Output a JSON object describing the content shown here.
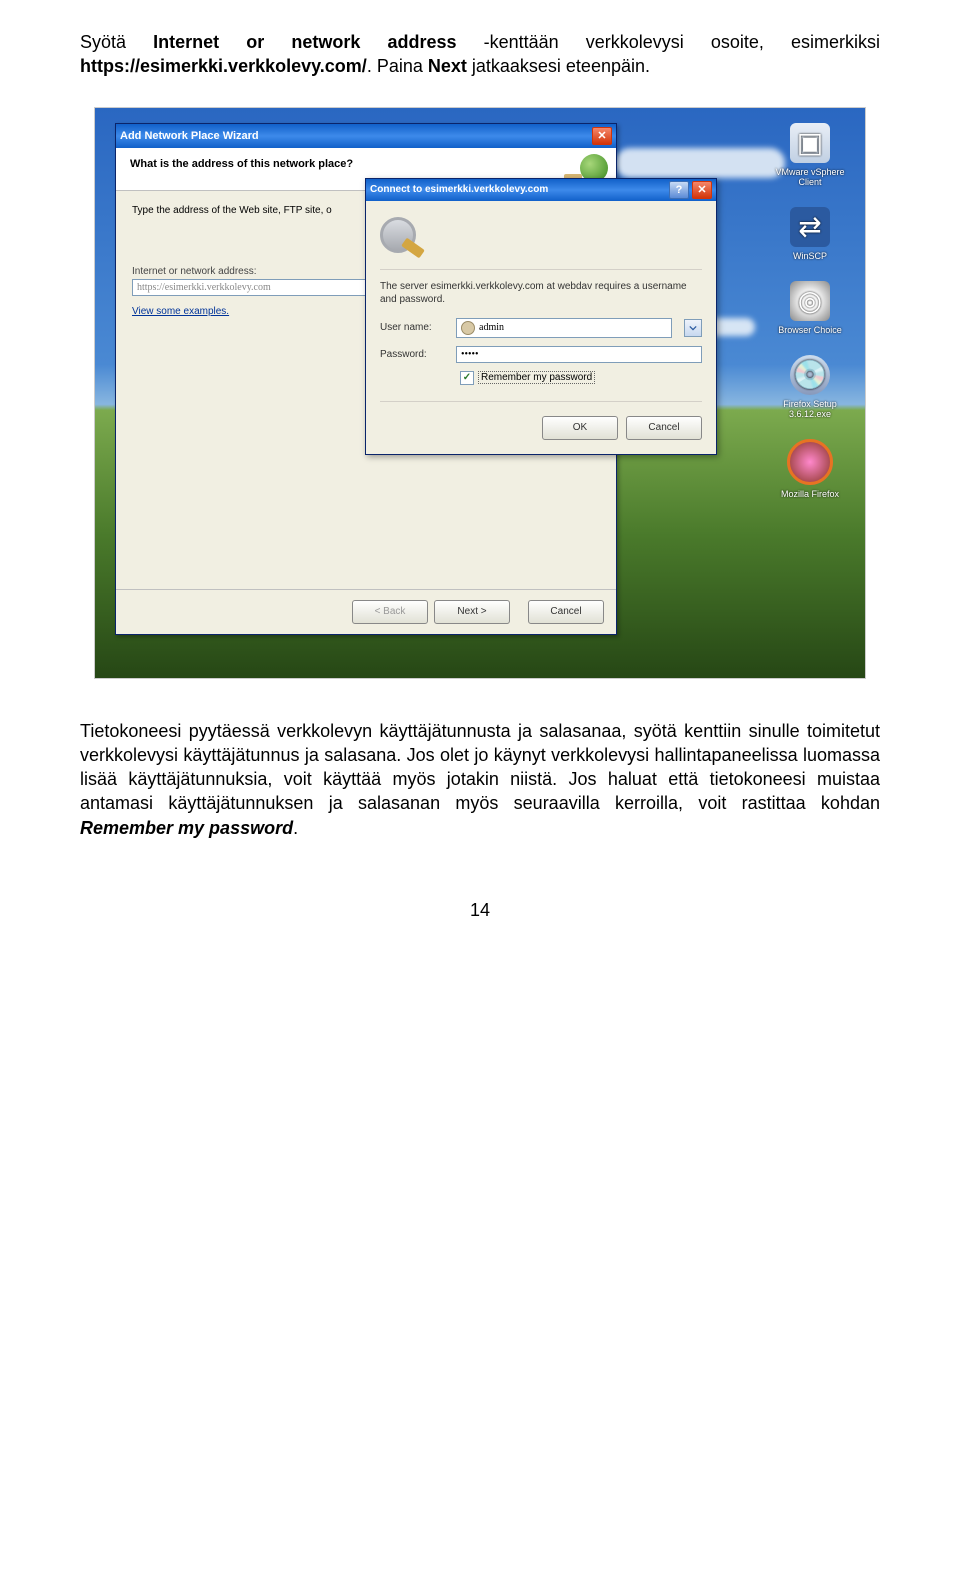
{
  "doc": {
    "p1a": "Syötä ",
    "p1b": "Internet or network address",
    "p1c": " -kenttään verkkolevysi osoite, esimerkiksi ",
    "p1url": "https://esimerkki.verkkolevy.com/",
    "p1d": ". Paina ",
    "p1next": "Next",
    "p1e": " jatkaaksesi eteenpäin."
  },
  "desktop_icons": [
    {
      "name": "vmware-icon",
      "label": "VMware vSphere Client"
    },
    {
      "name": "winscp-icon",
      "label": "WinSCP"
    },
    {
      "name": "browser-choice-icon",
      "label": "Browser Choice"
    },
    {
      "name": "firefox-setup-icon",
      "label": "Firefox Setup 3.6.12.exe"
    },
    {
      "name": "firefox-icon",
      "label": "Mozilla Firefox"
    }
  ],
  "wizard": {
    "title": "Add Network Place Wizard",
    "question": "What is the address of this network place?",
    "prompt": "Type the address of the Web site, FTP site, o",
    "addr_label": "Internet or network address:",
    "addr_value": "https://esimerkki.verkkolevy.com",
    "examples_link": "View some examples.",
    "btn_back": "< Back",
    "btn_next": "Next >",
    "btn_cancel": "Cancel"
  },
  "auth": {
    "title": "Connect to esimerkki.verkkolevy.com",
    "msg": "The server esimerkki.verkkolevy.com at webdav requires a username and password.",
    "user_label": "User name:",
    "user_value": "admin",
    "pass_label": "Password:",
    "pass_value": "•••••",
    "remember": "Remember my password",
    "btn_ok": "OK",
    "btn_cancel": "Cancel"
  },
  "doc2": {
    "p1": "Tietokoneesi pyytäessä verkkolevyn käyttäjätunnusta ja salasanaa, syötä kenttiin sinulle toimitetut verkkolevysi käyttäjätunnus ja salasana. Jos olet jo käynyt verkkolevysi hallintapaneelissa luomassa lisää käyttäjätunnuksia, voit käyttää myös jotakin niistä. Jos haluat että tietokoneesi muistaa antamasi käyttäjätunnuksen ja salasanan myös seuraavilla kerroilla, voit rastittaa kohdan ",
    "remember": "Remember my password",
    "period": "."
  },
  "page_number": "14"
}
